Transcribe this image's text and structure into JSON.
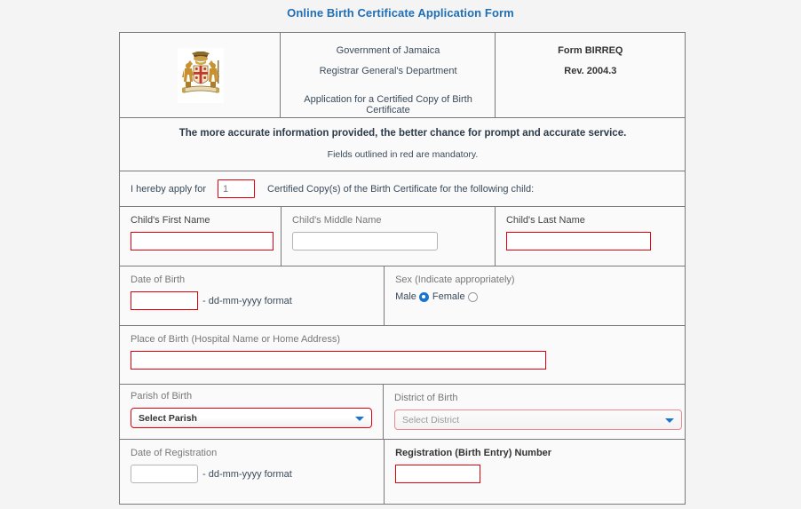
{
  "page": {
    "title": "Online Birth Certificate Application Form",
    "title_color": "#1f6fb5",
    "background_color": "#f4f4f4"
  },
  "header": {
    "emblem_name": "jamaica-coat-of-arms",
    "org_line1": "Government of Jamaica",
    "org_line2": "Registrar General's Department",
    "application_line": "Application for a Certified Copy of Birth Certificate",
    "form_code": "Form BIRREQ",
    "revision": "Rev. 2004.3"
  },
  "notice": {
    "primary": "The more accurate information provided, the better chance for prompt and accurate service.",
    "secondary": "Fields outlined in red are mandatory."
  },
  "apply": {
    "prefix": "I hereby apply for",
    "quantity_value": "1",
    "suffix": "Certified Copy(s) of the Birth Certificate for the following child:"
  },
  "child_name": {
    "first_label": "Child's First Name",
    "first_value": "",
    "middle_label": "Child's Middle Name",
    "middle_value": "",
    "last_label": "Child's Last Name",
    "last_value": ""
  },
  "birth": {
    "dob_label": "Date of Birth",
    "dob_value": "",
    "dob_hint": "- dd-mm-yyyy format",
    "sex_label": "Sex (Indicate appropriately)",
    "sex_male_label": "Male",
    "sex_female_label": "Female",
    "sex_selected": "Male",
    "place_label": "Place of Birth (Hospital Name or Home Address)",
    "place_value": ""
  },
  "location": {
    "parish_label": "Parish of Birth",
    "parish_selected": "Select Parish",
    "district_label": "District of Birth",
    "district_selected": "Select District"
  },
  "registration": {
    "date_label": "Date of Registration",
    "date_value": "",
    "date_hint": "- dd-mm-yyyy format",
    "number_label": "Registration (Birth Entry) Number",
    "number_value": ""
  },
  "colors": {
    "mandatory_border": "#e8000d",
    "optional_border": "#b4b4b4",
    "disabled_border": "#e98b90",
    "accent_blue": "#1b75d0",
    "table_border": "#7a7a7a"
  }
}
